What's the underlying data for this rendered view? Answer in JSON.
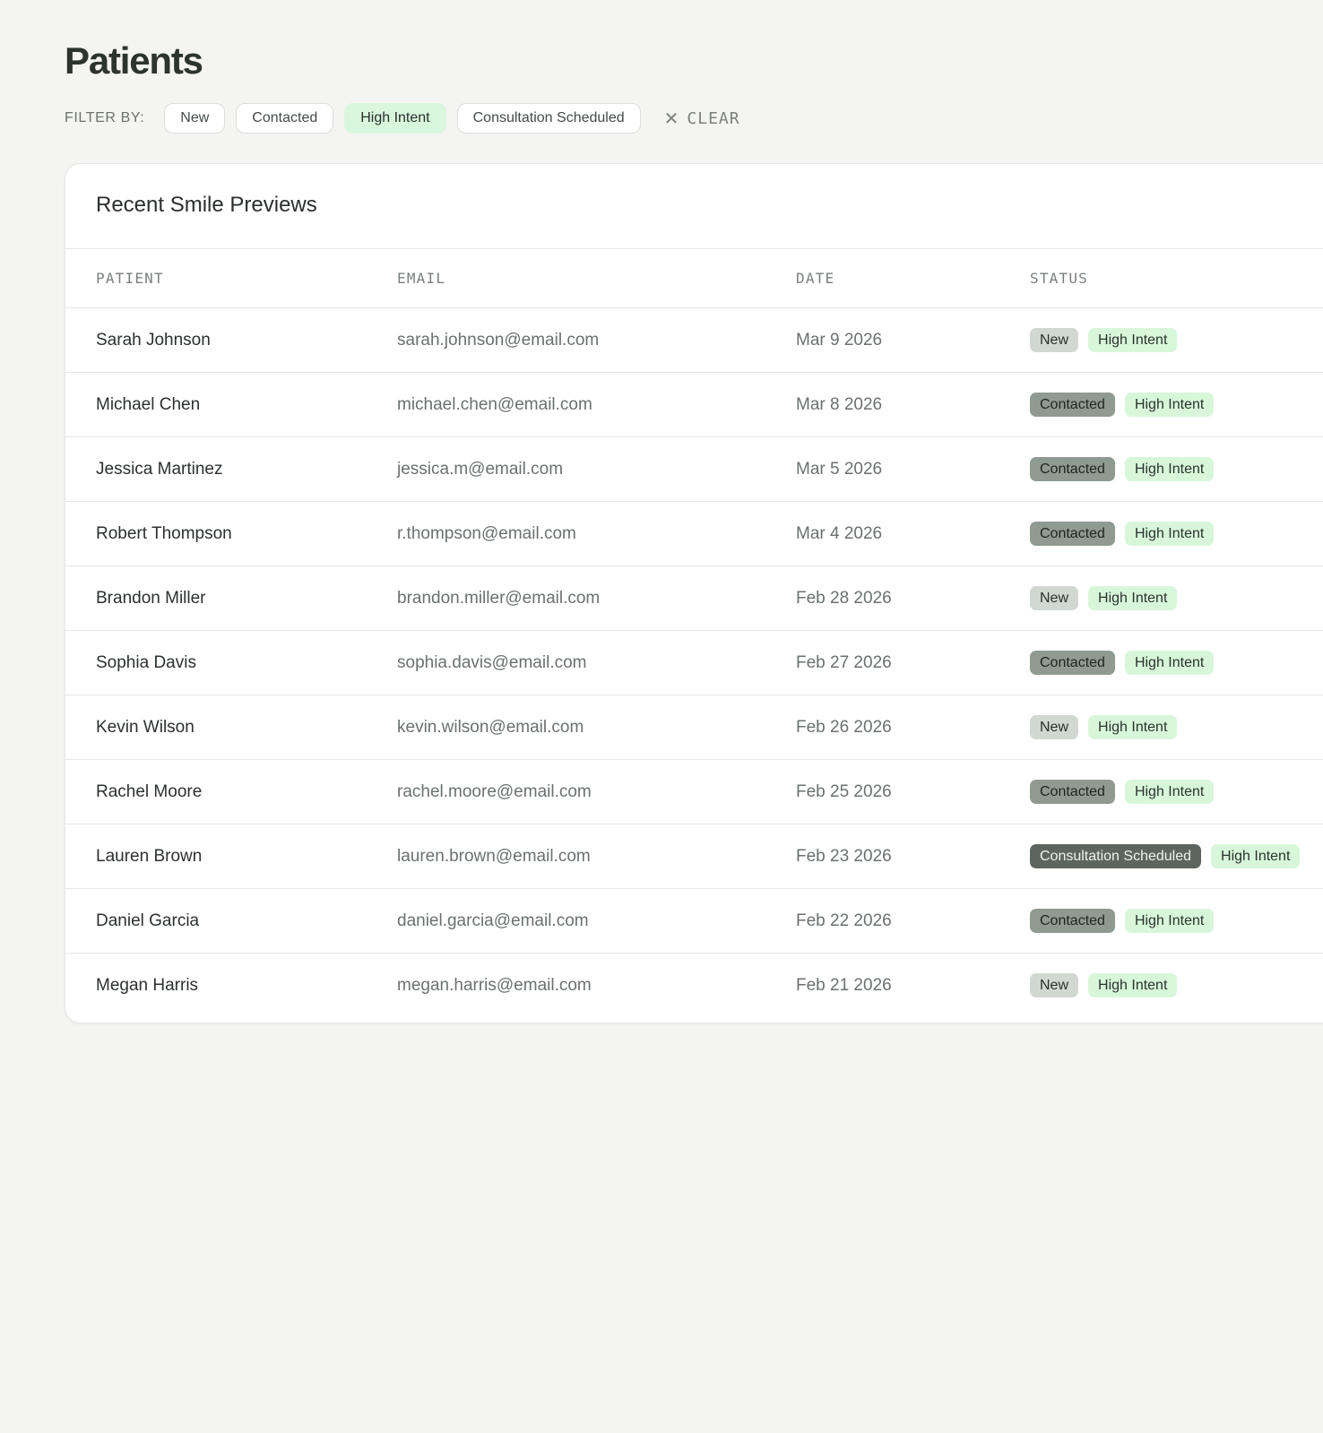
{
  "page": {
    "title": "Patients"
  },
  "filters": {
    "label": "FILTER BY:",
    "options": [
      "New",
      "Contacted",
      "High Intent",
      "Consultation Scheduled"
    ],
    "active": "High Intent",
    "clear_label": "CLEAR"
  },
  "card": {
    "title": "Recent Smile Previews"
  },
  "table": {
    "columns": {
      "patient": "PATIENT",
      "email": "EMAIL",
      "date": "DATE",
      "status": "STATUS"
    },
    "rows": [
      {
        "patient": "Sarah Johnson",
        "email": "sarah.johnson@email.com",
        "date": "Mar 9 2026",
        "status": "New",
        "intent": "High Intent"
      },
      {
        "patient": "Michael Chen",
        "email": "michael.chen@email.com",
        "date": "Mar 8 2026",
        "status": "Contacted",
        "intent": "High Intent"
      },
      {
        "patient": "Jessica Martinez",
        "email": "jessica.m@email.com",
        "date": "Mar 5 2026",
        "status": "Contacted",
        "intent": "High Intent"
      },
      {
        "patient": "Robert Thompson",
        "email": "r.thompson@email.com",
        "date": "Mar 4 2026",
        "status": "Contacted",
        "intent": "High Intent"
      },
      {
        "patient": "Brandon Miller",
        "email": "brandon.miller@email.com",
        "date": "Feb 28 2026",
        "status": "New",
        "intent": "High Intent"
      },
      {
        "patient": "Sophia Davis",
        "email": "sophia.davis@email.com",
        "date": "Feb 27 2026",
        "status": "Contacted",
        "intent": "High Intent"
      },
      {
        "patient": "Kevin Wilson",
        "email": "kevin.wilson@email.com",
        "date": "Feb 26 2026",
        "status": "New",
        "intent": "High Intent"
      },
      {
        "patient": "Rachel Moore",
        "email": "rachel.moore@email.com",
        "date": "Feb 25 2026",
        "status": "Contacted",
        "intent": "High Intent"
      },
      {
        "patient": "Lauren Brown",
        "email": "lauren.brown@email.com",
        "date": "Feb 23 2026",
        "status": "Consultation Scheduled",
        "intent": "High Intent"
      },
      {
        "patient": "Daniel Garcia",
        "email": "daniel.garcia@email.com",
        "date": "Feb 22 2026",
        "status": "Contacted",
        "intent": "High Intent"
      },
      {
        "patient": "Megan Harris",
        "email": "megan.harris@email.com",
        "date": "Feb 21 2026",
        "status": "New",
        "intent": "High Intent"
      }
    ]
  },
  "colors": {
    "background": "#f4f4f2",
    "accent_intent": "#d8f7da",
    "status_new": "#d1d8d2",
    "status_contacted": "#8f9a91",
    "status_scheduled": "#5c655f"
  },
  "icons": {
    "clear": "close-icon"
  }
}
